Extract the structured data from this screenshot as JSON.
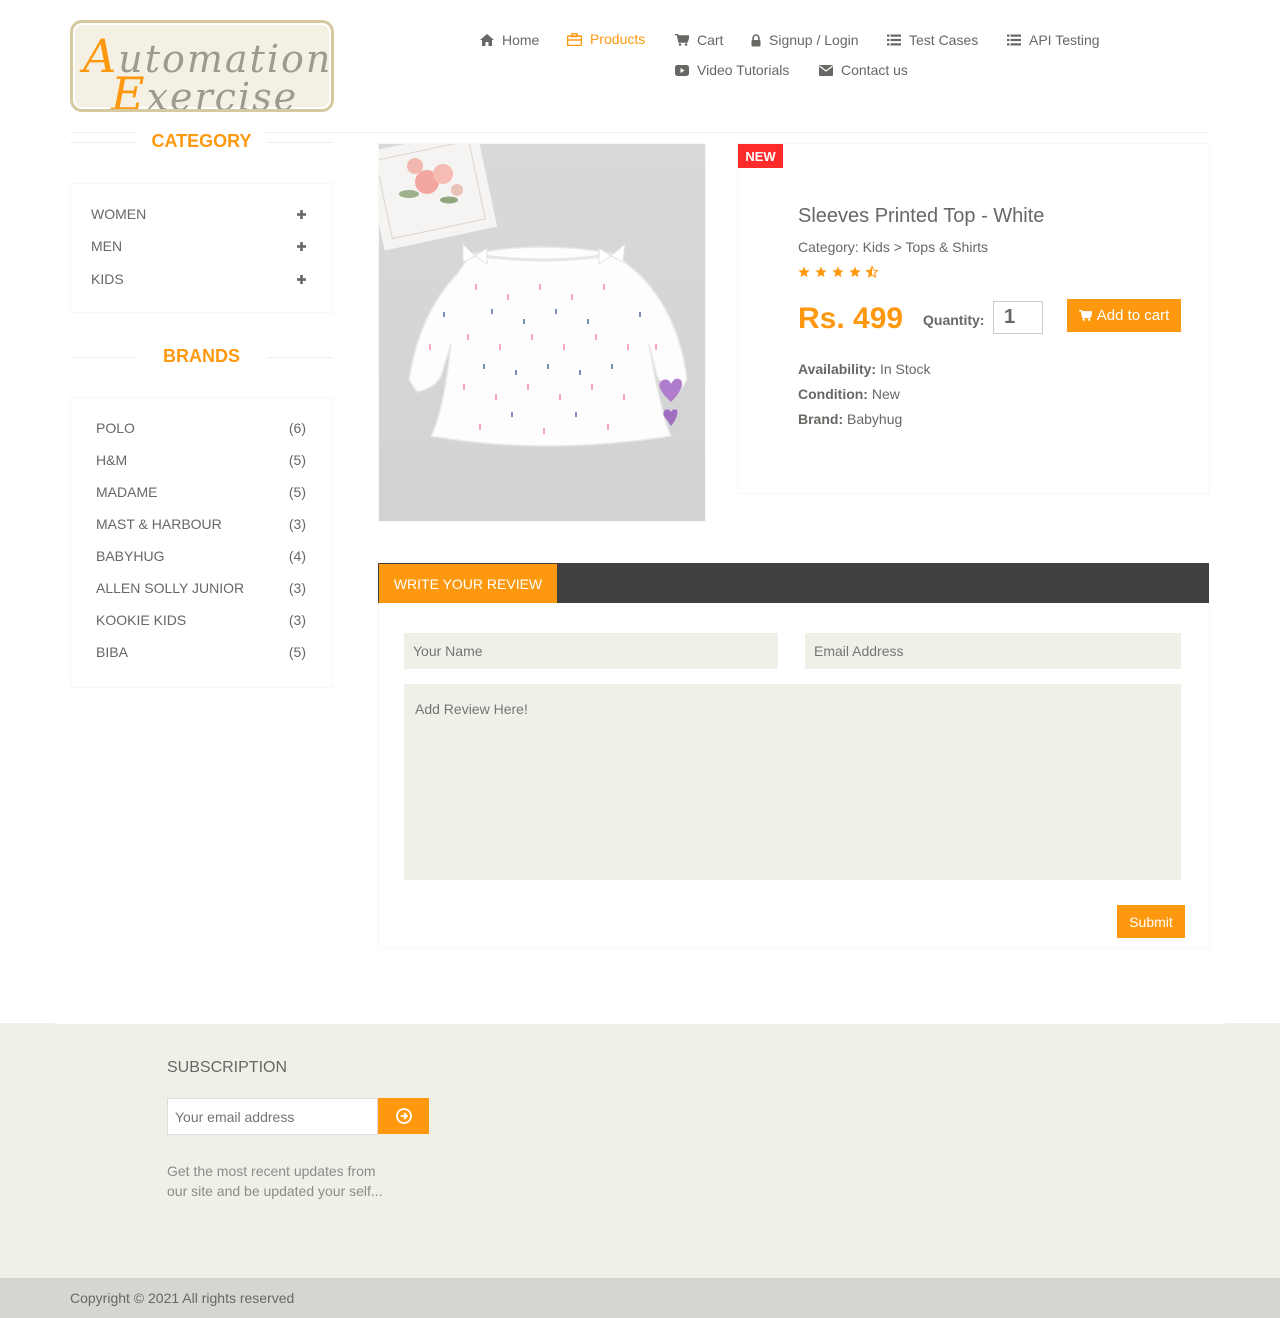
{
  "header": {
    "logo": {
      "line1_cap": "A",
      "line1_rest": "utomation",
      "line2_cap": "E",
      "line2_rest": "xercise"
    },
    "nav": [
      {
        "label": "Home",
        "icon": "home-icon",
        "active": false
      },
      {
        "label": "Products",
        "icon": "briefcase-icon",
        "active": true
      },
      {
        "label": "Cart",
        "icon": "cart-icon",
        "active": false
      },
      {
        "label": "Signup / Login",
        "icon": "lock-icon",
        "active": false
      },
      {
        "label": "Test Cases",
        "icon": "list-icon",
        "active": false
      },
      {
        "label": "API Testing",
        "icon": "list-icon",
        "active": false
      },
      {
        "label": "Video Tutorials",
        "icon": "youtube-play-icon",
        "active": false
      },
      {
        "label": "Contact us",
        "icon": "envelope-icon",
        "active": false
      }
    ]
  },
  "sidebar": {
    "category_title": "CATEGORY",
    "categories": [
      {
        "label": "WOMEN"
      },
      {
        "label": "MEN"
      },
      {
        "label": "KIDS"
      }
    ],
    "brands_title": "BRANDS",
    "brands": [
      {
        "name": "POLO",
        "count": "(6)"
      },
      {
        "name": "H&M",
        "count": "(5)"
      },
      {
        "name": "MADAME",
        "count": "(5)"
      },
      {
        "name": "MAST & HARBOUR",
        "count": "(3)"
      },
      {
        "name": "BABYHUG",
        "count": "(4)"
      },
      {
        "name": "ALLEN SOLLY JUNIOR",
        "count": "(3)"
      },
      {
        "name": "KOOKIE KIDS",
        "count": "(3)"
      },
      {
        "name": "BIBA",
        "count": "(5)"
      }
    ]
  },
  "product": {
    "badge": "NEW",
    "name": "Sleeves Printed Top - White",
    "category": "Category: Kids > Tops & Shirts",
    "rating": 4.5,
    "price": "Rs. 499",
    "quantity_label": "Quantity:",
    "quantity_value": "1",
    "add_to_cart": "Add to cart",
    "availability_label": "Availability:",
    "availability_value": "In Stock",
    "condition_label": "Condition:",
    "condition_value": "New",
    "brand_label": "Brand:",
    "brand_value": "Babyhug"
  },
  "review": {
    "tab_label": "WRITE YOUR REVIEW",
    "name_placeholder": "Your Name",
    "email_placeholder": "Email Address",
    "review_placeholder": "Add Review Here!",
    "submit_label": "Submit"
  },
  "footer": {
    "subscription_title": "SUBSCRIPTION",
    "email_placeholder": "Your email address",
    "subscription_text": "Get the most recent updates from our site and be updated your self...",
    "copyright": "Copyright © 2021 All rights reserved"
  },
  "colors": {
    "accent": "#fe980f",
    "text": "#696763",
    "badge_red": "#fe2b2b",
    "footer_bg": "#f0f0e9",
    "tab_bar": "#40403e"
  }
}
